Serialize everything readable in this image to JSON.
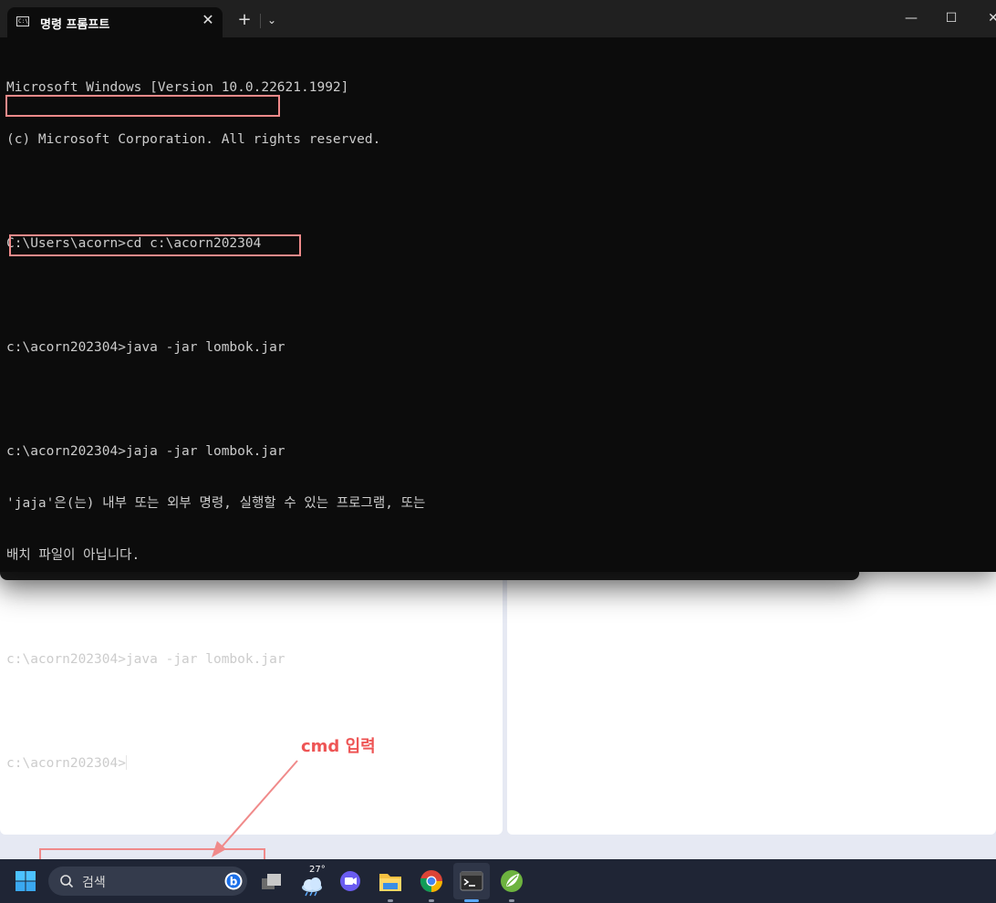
{
  "window": {
    "tab_title": "명령 프롬프트",
    "tab_icon_text": "C:\\",
    "close_tab_glyph": "✕",
    "new_tab_glyph": "+",
    "dropdown_glyph": "⌄",
    "minimize_glyph": "—",
    "maximize_glyph": "☐",
    "close_glyph": "✕"
  },
  "console": {
    "lines": [
      "Microsoft Windows [Version 10.0.22621.1992]",
      "(c) Microsoft Corporation. All rights reserved.",
      "",
      "C:\\Users\\acorn>cd c:\\acorn202304",
      "",
      "c:\\acorn202304>java -jar lombok.jar",
      "",
      "c:\\acorn202304>jaja -jar lombok.jar",
      "'jaja'은(는) 내부 또는 외부 명령, 실행할 수 있는 프로그램, 또는",
      "배치 파일이 아닙니다.",
      "",
      "c:\\acorn202304>java -jar lombok.jar",
      "",
      "c:\\acorn202304>"
    ]
  },
  "annotation": {
    "label": "cmd 입력",
    "color": "#ee5555"
  },
  "taskbar": {
    "search_placeholder": "검색",
    "weather_temp": "27°",
    "icons": [
      "windows-start-icon",
      "search-icon",
      "bing-icon",
      "task-view-icon",
      "weather-icon",
      "meet-icon",
      "file-explorer-icon",
      "chrome-icon",
      "terminal-icon",
      "spring-icon"
    ]
  },
  "colors": {
    "console_bg": "#0c0c0c",
    "console_text": "#cccccc",
    "titlebar_bg": "#202020",
    "taskbar_bg": "#1f2535",
    "highlight": "#f08a8a"
  }
}
